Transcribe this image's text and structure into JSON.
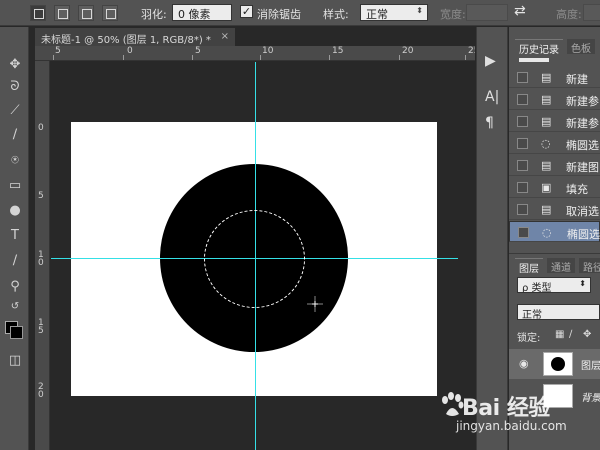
{
  "options_bar": {
    "feather_label": "羽化:",
    "feather_value": "0 像素",
    "antialias_label": "消除锯齿",
    "antialias_checked": "✓",
    "style_label": "样式:",
    "style_value": "正常",
    "width_label": "宽度:",
    "height_label": "高度:"
  },
  "document": {
    "tab_title": "未标题-1 @ 50% (图层 1, RGB/8*) *",
    "close_glyph": "×"
  },
  "rulers": {
    "h_numbers": [
      "5",
      "0",
      "5",
      "10",
      "15",
      "20",
      "25"
    ],
    "v_numbers": [
      "0",
      "5",
      "1 0",
      "1 5",
      "2 0"
    ]
  },
  "history_panel": {
    "tab_active": "历史记录",
    "tab_other": "色板",
    "items": [
      {
        "label": "新建",
        "icon": "document-icon"
      },
      {
        "label": "新建参",
        "icon": "document-icon"
      },
      {
        "label": "新建参",
        "icon": "document-icon"
      },
      {
        "label": "椭圆选",
        "icon": "ellipse-select-icon"
      },
      {
        "label": "新建图",
        "icon": "document-icon"
      },
      {
        "label": "填充",
        "icon": "fill-icon"
      },
      {
        "label": "取消选",
        "icon": "document-icon"
      },
      {
        "label": "椭圆选",
        "icon": "ellipse-select-icon"
      }
    ]
  },
  "layers_panel": {
    "tab_active": "图层",
    "tab_channels": "通道",
    "tab_paths": "路径",
    "filter_value": "ρ 类型",
    "blend_mode": "正常",
    "lock_label": "锁定:",
    "layers": [
      {
        "name": "图层"
      },
      {
        "name": "背景"
      }
    ]
  },
  "watermark": {
    "brand_text": "Bai 经验",
    "url": "jingyan.baidu.com"
  },
  "colors": {
    "guide": "#35e0e6",
    "history_selected": "#6f85a8",
    "canvas_bg": "#282828",
    "panel_bg": "#535353"
  }
}
